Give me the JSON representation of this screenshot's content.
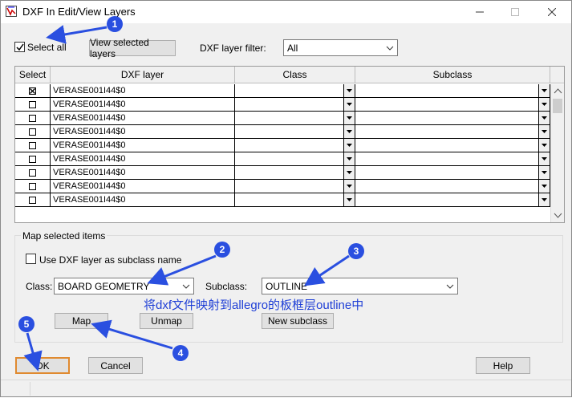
{
  "window": {
    "title": "DXF In Edit/View Layers"
  },
  "top": {
    "select_all_label": "Select all",
    "select_all_checked": true,
    "view_selected_label": "View selected layers",
    "filter_label": "DXF layer filter:",
    "filter_value": "All"
  },
  "grid": {
    "headers": [
      "Select",
      "DXF layer",
      "Class",
      "Subclass"
    ],
    "rows": [
      {
        "checked": true,
        "layer": "VERASE001I44$0",
        "class": "",
        "subclass": ""
      },
      {
        "checked": false,
        "layer": "VERASE001I44$0",
        "class": "",
        "subclass": ""
      },
      {
        "checked": false,
        "layer": "VERASE001I44$0",
        "class": "",
        "subclass": ""
      },
      {
        "checked": false,
        "layer": "VERASE001I44$0",
        "class": "",
        "subclass": ""
      },
      {
        "checked": false,
        "layer": "VERASE001I44$0",
        "class": "",
        "subclass": ""
      },
      {
        "checked": false,
        "layer": "VERASE001I44$0",
        "class": "",
        "subclass": ""
      },
      {
        "checked": false,
        "layer": "VERASE001I44$0",
        "class": "",
        "subclass": ""
      },
      {
        "checked": false,
        "layer": "VERASE001I44$0",
        "class": "",
        "subclass": ""
      },
      {
        "checked": false,
        "layer": "VERASE001I44$0",
        "class": "",
        "subclass": ""
      }
    ]
  },
  "map_group": {
    "title": "Map selected items",
    "use_dxf_label": "Use DXF layer as subclass name",
    "class_label": "Class:",
    "class_value": "BOARD GEOMETRY",
    "subclass_label": "Subclass:",
    "subclass_value": "OUTLINE",
    "map_label": "Map",
    "unmap_label": "Unmap",
    "new_subclass_label": "New subclass"
  },
  "footer": {
    "ok_label": "OK",
    "cancel_label": "Cancel",
    "help_label": "Help"
  },
  "annotations": {
    "badges": [
      "1",
      "2",
      "3",
      "4",
      "5"
    ],
    "note": "将dxf文件映射到allegro的板框层outline中",
    "color": "#1f3fd6"
  }
}
